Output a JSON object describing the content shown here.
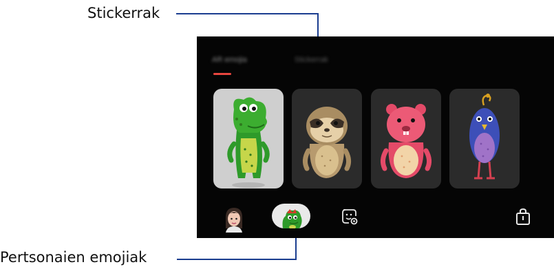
{
  "callouts": {
    "stickers": "Stickerrak",
    "character_emojis": "Pertsonaien emojiak"
  },
  "tabs": [
    {
      "label": "AR emojia",
      "active": true
    },
    {
      "label": "Stickerrak",
      "active": false
    }
  ],
  "colors": {
    "accent": "#e8463f",
    "callout_line": "#1a3d8f",
    "background": "#050505"
  },
  "characters": [
    {
      "name": "dinosaur",
      "selected": true
    },
    {
      "name": "sloth",
      "selected": false
    },
    {
      "name": "pink-bear",
      "selected": false
    },
    {
      "name": "blue-bird",
      "selected": false
    }
  ],
  "bottom_bar": {
    "icons": [
      "avatar-icon",
      "character-emoji-icon",
      "sticker-settings-icon",
      "store-icon"
    ]
  }
}
